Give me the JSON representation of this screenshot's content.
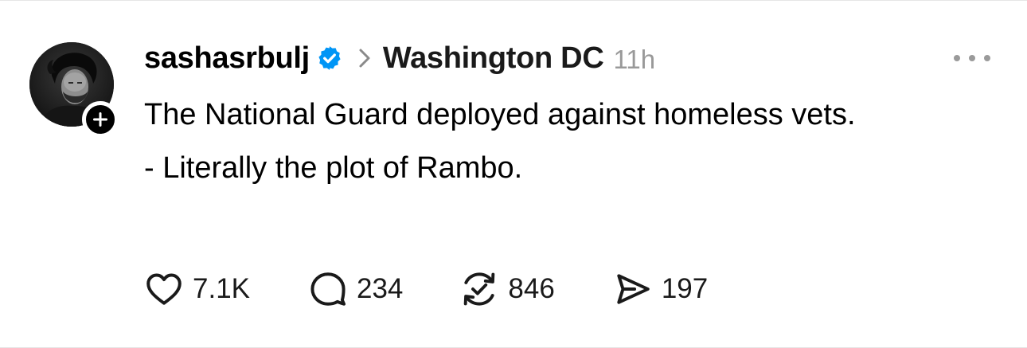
{
  "post": {
    "author": {
      "username": "sashasrbulj",
      "verified": true,
      "avatar_icon": "profile-photo",
      "follow_icon": "plus-icon"
    },
    "topic_separator_icon": "chevron-right-icon",
    "topic": "Washington DC",
    "time": "11h",
    "more_icon": "more-dots-icon",
    "body": [
      "The National Guard deployed against homeless vets.",
      "- Literally the plot of Rambo."
    ],
    "actions": {
      "like": {
        "icon": "heart-icon",
        "count": "7.1K"
      },
      "reply": {
        "icon": "comment-icon",
        "count": "234"
      },
      "repost": {
        "icon": "repost-icon",
        "count": "846"
      },
      "share": {
        "icon": "send-icon",
        "count": "197"
      }
    },
    "colors": {
      "verified_badge": "#0095f6",
      "muted_text": "#999999",
      "text": "#000000"
    }
  }
}
